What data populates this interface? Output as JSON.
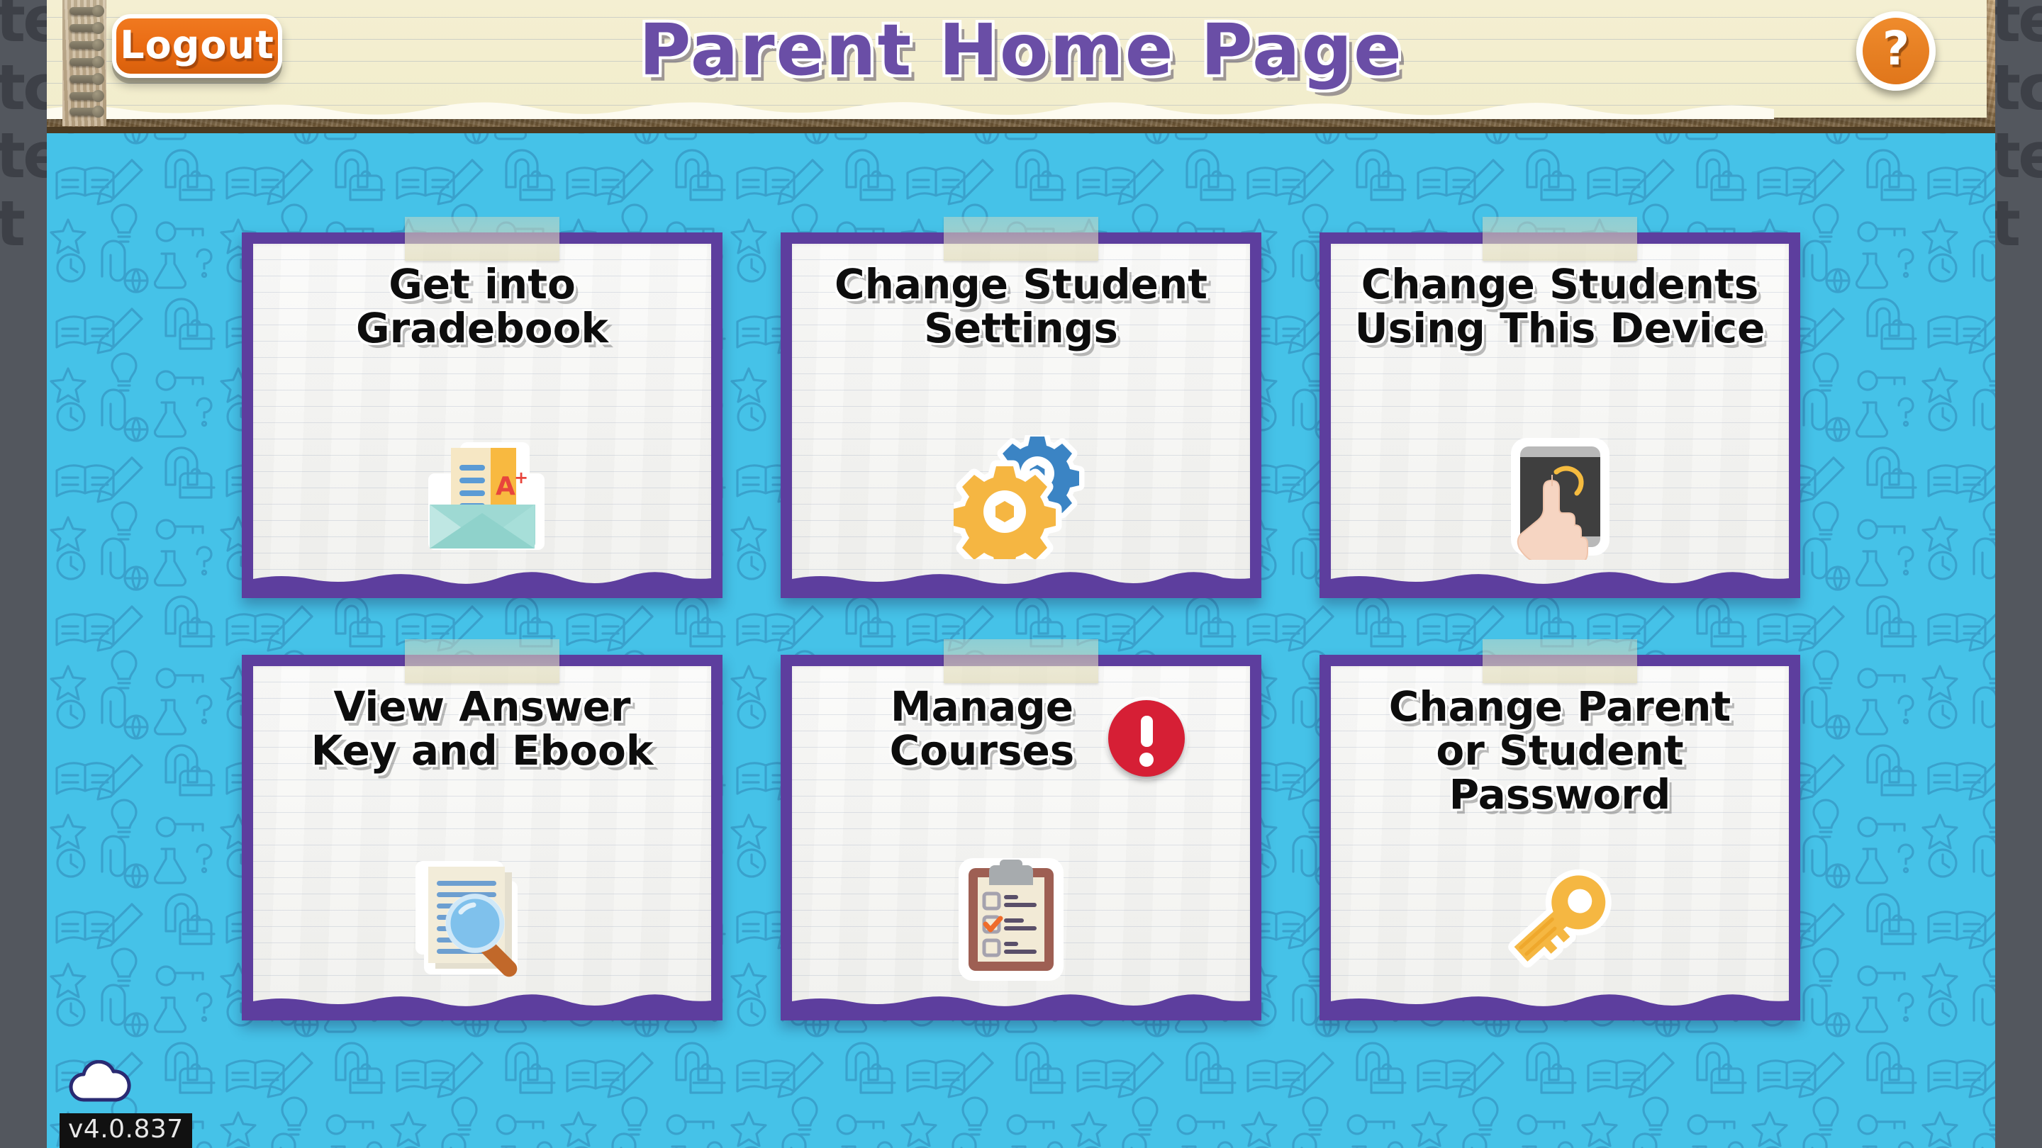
{
  "header": {
    "logout_label": "Logout",
    "title": "Parent Home Page",
    "help_label": "?"
  },
  "cards": [
    {
      "title_line1": "Get into",
      "title_line2": "Gradebook",
      "icon": "envelope-grade-icon",
      "badge": null
    },
    {
      "title_line1": "Change Student",
      "title_line2": "Settings",
      "icon": "gears-icon",
      "badge": null
    },
    {
      "title_line1": "Change Students",
      "title_line2": "Using This Device",
      "icon": "tablet-tap-icon",
      "badge": null
    },
    {
      "title_line1": "View Answer",
      "title_line2": "Key and Ebook",
      "icon": "document-search-icon",
      "badge": null
    },
    {
      "title_line1": "Manage",
      "title_line2": "Courses",
      "icon": "clipboard-checklist-icon",
      "badge": "alert-exclamation-badge"
    },
    {
      "title_line1": "Change Parent",
      "title_line2": "or Student Password",
      "icon": "key-icon",
      "badge": null
    }
  ],
  "footer": {
    "version": "v4.0.837",
    "cloud_icon": "cloud-icon"
  },
  "colors": {
    "background_blue": "#45c2e8",
    "card_border_purple": "#5d3e9e",
    "accent_orange": "#e96a12",
    "title_purple": "#6a4ea6",
    "alert_red": "#d61f35",
    "paper_cream": "#f4efd2"
  },
  "side_ghost_text": "te\ntc\nte\nt"
}
